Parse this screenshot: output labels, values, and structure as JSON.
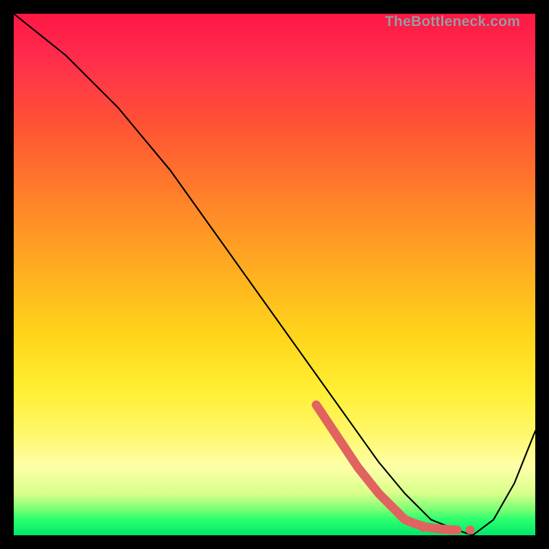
{
  "watermark": {
    "text": "TheBottleneck.com"
  },
  "chart_data": {
    "type": "line",
    "title": "",
    "xlabel": "",
    "ylabel": "",
    "ylim": [
      0,
      100
    ],
    "xlim": [
      0,
      100
    ],
    "series": [
      {
        "name": "bottleneck-curve",
        "x": [
          0,
          5,
          10,
          15,
          20,
          25,
          30,
          35,
          40,
          45,
          50,
          55,
          60,
          65,
          70,
          75,
          80,
          85,
          88,
          92,
          96,
          100
        ],
        "values": [
          100,
          96,
          92,
          87,
          82,
          76,
          70,
          63,
          56,
          49,
          42,
          35,
          28,
          21,
          14,
          8,
          3,
          1,
          0,
          3,
          10,
          20
        ]
      }
    ],
    "highlight_segment": {
      "name": "optimal-zone",
      "x": [
        58,
        62,
        66,
        70,
        73,
        75,
        77,
        79,
        81,
        83,
        85
      ],
      "values": [
        25,
        19,
        13,
        8,
        5,
        3,
        2.2,
        1.6,
        1.3,
        1.1,
        1.0
      ]
    },
    "highlight_dots": {
      "x": [
        78.5,
        81.5,
        84.0,
        87.5
      ],
      "values": [
        1.5,
        1.2,
        1.0,
        1.0
      ]
    }
  }
}
